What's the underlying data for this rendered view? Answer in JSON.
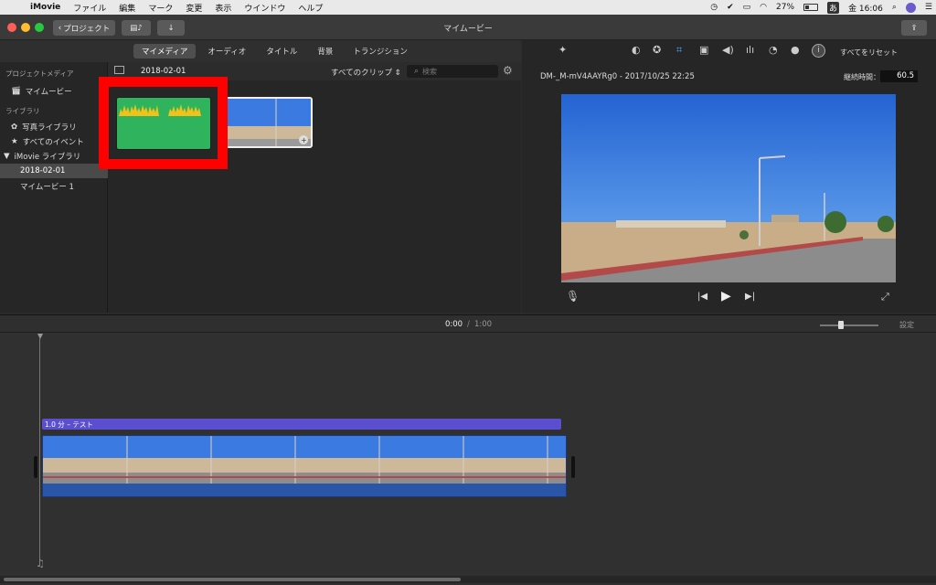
{
  "menubar": {
    "app_name": "iMovie",
    "items": [
      "ファイル",
      "編集",
      "マーク",
      "変更",
      "表示",
      "ウインドウ",
      "ヘルプ"
    ],
    "battery": "27%",
    "ime": "あ",
    "clock": "金 16:06"
  },
  "toolbar": {
    "back_label": "プロジェクト",
    "window_title": "マイムービー"
  },
  "browser_tabs": [
    "マイメディア",
    "オーディオ",
    "タイトル",
    "背景",
    "トランジション"
  ],
  "sidebar": {
    "section_project_media": "プロジェクトメディア",
    "project_item": "マイムービー",
    "section_libraries": "ライブラリ",
    "photos_library": "写真ライブラリ",
    "all_events": "すべてのイベント",
    "imovie_library": "iMovie ライブラリ",
    "event_selected": "2018-02-01",
    "movie_item": "マイムービー 1"
  },
  "browser": {
    "event_date": "2018-02-01",
    "filter_label": "すべてのクリップ",
    "search_placeholder": "検索"
  },
  "viewer": {
    "clip_name": "DM-_M-mV4AAYRg0 - 2017/10/25 22:25",
    "reset_all": "すべてをリセット",
    "duration_label": "継続時間：",
    "duration_value": "60.5"
  },
  "timeline": {
    "current_time": "0:00",
    "separator": "/",
    "total_time": "1:00",
    "settings_label": "設定",
    "title_clip_label": "1.0 分 – テスト"
  },
  "colors": {
    "highlight_box": "#ff0000",
    "audio_clip_bg": "#2fb35d",
    "waveform": "#f2c11a",
    "title_bar": "#5b4fcf",
    "video_track_bottom": "#2a55a8",
    "sky": "#2f6ed8"
  }
}
